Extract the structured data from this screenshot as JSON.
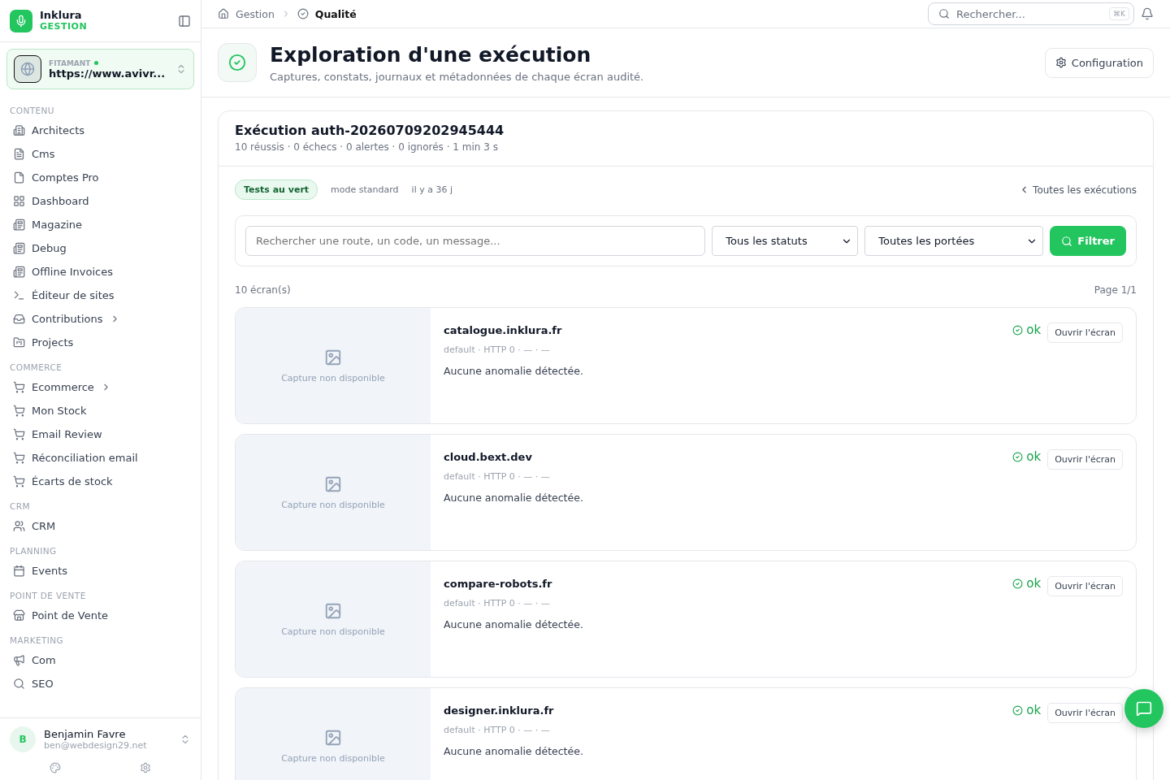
{
  "brand": {
    "name": "Inklura",
    "subtitle": "GESTION"
  },
  "workspace": {
    "label": "FITAMANT",
    "online": true,
    "url": "https://www.avivr..."
  },
  "sidebar": {
    "sections": [
      {
        "title": "CONTENU",
        "items": [
          {
            "label": "Architects",
            "expandable": false
          },
          {
            "label": "Cms",
            "expandable": false
          },
          {
            "label": "Comptes Pro",
            "expandable": false
          },
          {
            "label": "Dashboard",
            "expandable": false
          },
          {
            "label": "Magazine",
            "expandable": false
          },
          {
            "label": "Debug",
            "expandable": false
          },
          {
            "label": "Offline Invoices",
            "expandable": false
          },
          {
            "label": "Éditeur de sites",
            "expandable": false
          },
          {
            "label": "Contributions",
            "expandable": true
          },
          {
            "label": "Projects",
            "expandable": false
          }
        ]
      },
      {
        "title": "COMMERCE",
        "items": [
          {
            "label": "Ecommerce",
            "expandable": true
          },
          {
            "label": "Mon Stock",
            "expandable": false
          },
          {
            "label": "Email Review",
            "expandable": false
          },
          {
            "label": "Réconciliation email",
            "expandable": false
          },
          {
            "label": "Écarts de stock",
            "expandable": false
          }
        ]
      },
      {
        "title": "CRM",
        "items": [
          {
            "label": "CRM",
            "expandable": false
          }
        ]
      },
      {
        "title": "PLANNING",
        "items": [
          {
            "label": "Events",
            "expandable": false
          }
        ]
      },
      {
        "title": "POINT DE VENTE",
        "items": [
          {
            "label": "Point de Vente",
            "expandable": false
          }
        ]
      },
      {
        "title": "MARKETING",
        "items": [
          {
            "label": "Com",
            "expandable": false
          },
          {
            "label": "SEO",
            "expandable": false
          }
        ]
      }
    ]
  },
  "user": {
    "initial": "B",
    "name": "Benjamin Favre",
    "email": "ben@webdesign29.net"
  },
  "breadcrumb": [
    "Gestion",
    "Qualité"
  ],
  "search": {
    "placeholder": "Rechercher...",
    "shortcut": "⌘K"
  },
  "header": {
    "title": "Exploration d'une exécution",
    "subtitle": "Captures, constats, journaux et métadonnées de chaque écran audité.",
    "button": "Configuration"
  },
  "run": {
    "title": "Exécution auth-20260709202945444",
    "summary": "10 réussis · 0 échecs · 0 alertes · 0 ignorés · 1 min 3 s",
    "badge": "Tests au vert",
    "mode": "mode standard",
    "age": "il y a 36 j",
    "back_link": "Toutes les exécutions"
  },
  "filters": {
    "placeholder": "Rechercher une route, un code, un message...",
    "status": "Tous les statuts",
    "scope": "Toutes les portées",
    "button": "Filtrer"
  },
  "count": "10 écran(s)",
  "page": "Page 1/1",
  "screens": [
    {
      "placeholder": "Capture non disponible",
      "host": "catalogue.inklura.fr",
      "meta": "default · HTTP 0 · — · —",
      "message": "Aucune anomalie détectée.",
      "status": "ok",
      "kind": "success",
      "button": "Ouvrir l'écran"
    },
    {
      "placeholder": "Capture non disponible",
      "host": "cloud.bext.dev",
      "meta": "default · HTTP 0 · — · —",
      "message": "Aucune anomalie détectée.",
      "status": "ok",
      "kind": "success",
      "button": "Ouvrir l'écran"
    },
    {
      "placeholder": "Capture non disponible",
      "host": "compare-robots.fr",
      "meta": "default · HTTP 0 · — · —",
      "message": "Aucune anomalie détectée.",
      "status": "ok",
      "kind": "success",
      "button": "Ouvrir l'écran"
    },
    {
      "placeholder": "Capture non disponible",
      "host": "designer.inklura.fr",
      "meta": "default · HTTP 0 · — · —",
      "message": "Aucune anomalie détectée.",
      "status": "ok",
      "kind": "success",
      "button": "Ouvrir l'écran"
    }
  ]
}
